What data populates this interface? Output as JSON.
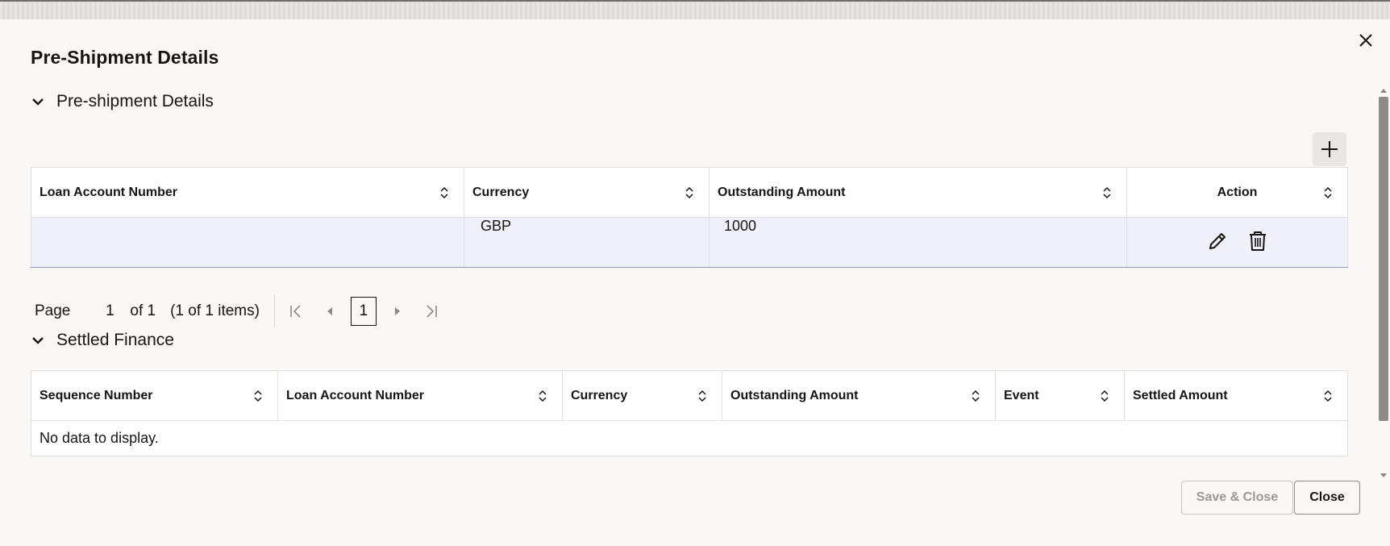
{
  "dialog": {
    "title": "Pre-Shipment Details",
    "close_icon": "close-icon"
  },
  "preshipment": {
    "section_label": "Pre-shipment Details",
    "add_icon": "plus-icon",
    "columns": [
      "Loan Account Number",
      "Currency",
      "Outstanding Amount",
      "Action"
    ],
    "rows": [
      {
        "loan_account_number": "",
        "currency": "GBP",
        "outstanding_amount": "1000",
        "actions": [
          "edit-icon",
          "trash-icon"
        ]
      }
    ]
  },
  "pager": {
    "page_label": "Page",
    "current_page": "1",
    "of_label": "of 1",
    "items_label": "(1 of 1 items)",
    "page_button": "1"
  },
  "settled": {
    "section_label": "Settled Finance",
    "columns": [
      "Sequence Number",
      "Loan Account Number",
      "Currency",
      "Outstanding Amount",
      "Event",
      "Settled Amount"
    ],
    "empty_text": "No data to display."
  },
  "footer": {
    "save_close_label": "Save & Close",
    "close_label": "Close"
  },
  "colors": {
    "selected_row": "#eef1fa",
    "disabled_text": "#9a9794",
    "scroll_thumb": "#8f8d8b"
  }
}
